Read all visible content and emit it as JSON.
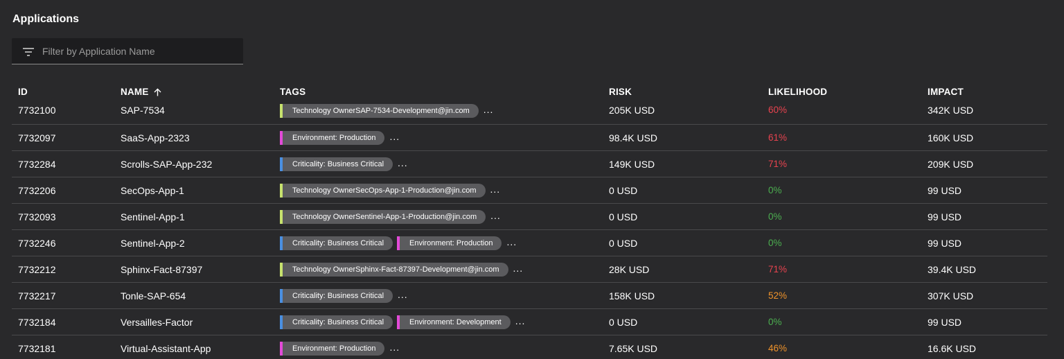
{
  "section": {
    "title": "Applications"
  },
  "filter": {
    "placeholder": "Filter by Application Name",
    "icon": "filter-icon"
  },
  "colors": {
    "background": "#29292b",
    "high_likelihood": "#e8434f",
    "medium_likelihood": "#f0932b",
    "low_likelihood": "#4caf50",
    "tag_technology_owner": "#c7e26e",
    "tag_environment": "#e34ad8",
    "tag_criticality": "#4a90e2"
  },
  "table": {
    "columns": {
      "id": "ID",
      "name": "NAME",
      "tags": "TAGS",
      "risk": "RISK",
      "likelihood": "LIKELIHOOD",
      "impact": "IMPACT"
    },
    "sort": {
      "column": "name",
      "direction": "ascending",
      "icon": "arrow-up-icon"
    },
    "more_indicator": "...",
    "rows": [
      {
        "id": "7732100",
        "name": "SAP-7534",
        "tags": [
          {
            "label": "Technology OwnerSAP-7534-Development@jin.com",
            "color": "#c7e26e"
          }
        ],
        "risk": "205K USD",
        "likelihood": "60%",
        "likelihood_color": "#e8434f",
        "impact": "342K USD"
      },
      {
        "id": "7732097",
        "name": "SaaS-App-2323",
        "tags": [
          {
            "label": "Environment: Production",
            "color": "#e34ad8"
          }
        ],
        "risk": "98.4K USD",
        "likelihood": "61%",
        "likelihood_color": "#e8434f",
        "impact": "160K USD"
      },
      {
        "id": "7732284",
        "name": "Scrolls-SAP-App-232",
        "tags": [
          {
            "label": "Criticality: Business Critical",
            "color": "#4a90e2"
          }
        ],
        "risk": "149K USD",
        "likelihood": "71%",
        "likelihood_color": "#e8434f",
        "impact": "209K USD"
      },
      {
        "id": "7732206",
        "name": "SecOps-App-1",
        "tags": [
          {
            "label": "Technology OwnerSecOps-App-1-Production@jin.com",
            "color": "#c7e26e"
          }
        ],
        "risk": "0 USD",
        "likelihood": "0%",
        "likelihood_color": "#4caf50",
        "impact": "99 USD"
      },
      {
        "id": "7732093",
        "name": "Sentinel-App-1",
        "tags": [
          {
            "label": "Technology OwnerSentinel-App-1-Production@jin.com",
            "color": "#c7e26e"
          }
        ],
        "risk": "0 USD",
        "likelihood": "0%",
        "likelihood_color": "#4caf50",
        "impact": "99 USD"
      },
      {
        "id": "7732246",
        "name": "Sentinel-App-2",
        "tags": [
          {
            "label": "Criticality: Business Critical",
            "color": "#4a90e2"
          },
          {
            "label": "Environment: Production",
            "color": "#e34ad8"
          }
        ],
        "risk": "0 USD",
        "likelihood": "0%",
        "likelihood_color": "#4caf50",
        "impact": "99 USD"
      },
      {
        "id": "7732212",
        "name": "Sphinx-Fact-87397",
        "tags": [
          {
            "label": "Technology OwnerSphinx-Fact-87397-Development@jin.com",
            "color": "#c7e26e"
          }
        ],
        "risk": "28K USD",
        "likelihood": "71%",
        "likelihood_color": "#e8434f",
        "impact": "39.4K USD"
      },
      {
        "id": "7732217",
        "name": "Tonle-SAP-654",
        "tags": [
          {
            "label": "Criticality: Business Critical",
            "color": "#4a90e2"
          }
        ],
        "risk": "158K USD",
        "likelihood": "52%",
        "likelihood_color": "#f0932b",
        "impact": "307K USD"
      },
      {
        "id": "7732184",
        "name": "Versailles-Factor",
        "tags": [
          {
            "label": "Criticality: Business Critical",
            "color": "#4a90e2"
          },
          {
            "label": "Environment: Development",
            "color": "#e34ad8"
          }
        ],
        "risk": "0 USD",
        "likelihood": "0%",
        "likelihood_color": "#4caf50",
        "impact": "99 USD"
      },
      {
        "id": "7732181",
        "name": "Virtual-Assistant-App",
        "tags": [
          {
            "label": "Environment: Production",
            "color": "#e34ad8"
          }
        ],
        "risk": "7.65K USD",
        "likelihood": "46%",
        "likelihood_color": "#f0932b",
        "impact": "16.6K USD"
      }
    ]
  }
}
